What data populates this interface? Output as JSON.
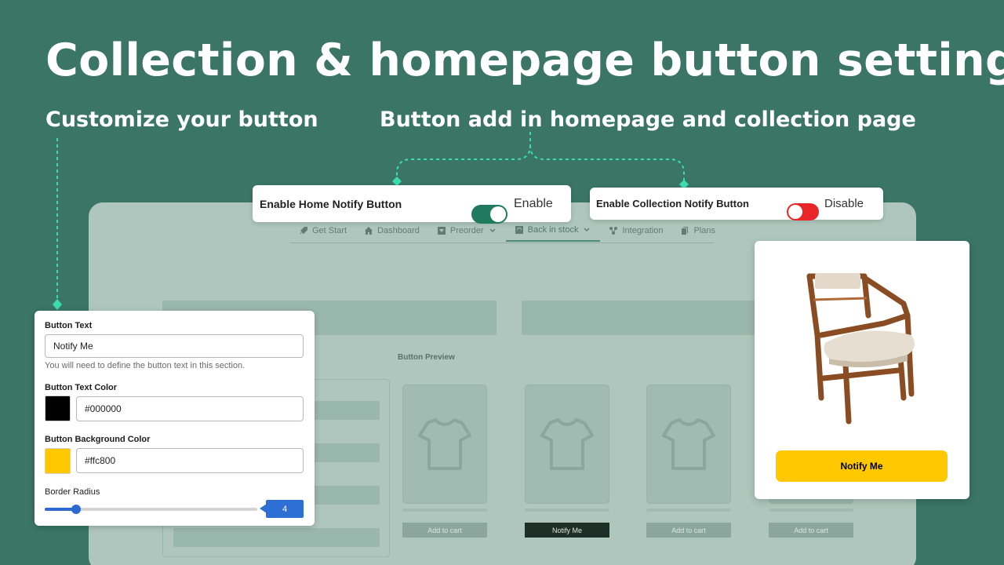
{
  "headline": "Collection & homepage button settings",
  "subheading_left": "Customize your button",
  "subheading_right": "Button add in homepage and collection page",
  "home_toggle": {
    "label": "Enable Home Notify Button",
    "state": "Enable",
    "on": true,
    "color": "#1f7a5e"
  },
  "collection_toggle": {
    "label": "Enable Collection Notify Button",
    "state": "Disable",
    "on": false,
    "color": "#e8262a"
  },
  "nav": {
    "items": [
      {
        "label": "Get Start",
        "icon": "rocket-icon"
      },
      {
        "label": "Dashboard",
        "icon": "home-icon"
      },
      {
        "label": "Preorder",
        "icon": "download-box-icon"
      },
      {
        "label": "Back in stock",
        "icon": "refresh-box-icon"
      },
      {
        "label": "Integration",
        "icon": "integration-icon"
      },
      {
        "label": "Plans",
        "icon": "plans-icon"
      }
    ]
  },
  "preview": {
    "title": "Button Preview",
    "buttons": [
      "Add to cart",
      "Notify Me",
      "Add to cart",
      "Add to cart"
    ]
  },
  "settings": {
    "button_text_label": "Button Text",
    "button_text_value": "Notify Me",
    "button_text_help": "You will need to define the button text in this section.",
    "text_color_label": "Button Text Color",
    "text_color_value": "#000000",
    "bg_color_label": "Button Background Color",
    "bg_color_value": "#ffc800",
    "radius_label": "Border Radius",
    "radius_value": "4",
    "radius_fraction": 0.15
  },
  "product": {
    "button_label": "Notify Me",
    "button_bg": "#ffc800",
    "button_text_color": "#000000"
  },
  "colors": {
    "background": "#3a7565",
    "accent_dashed": "#3ddbb0",
    "slider": "#2b6ad1"
  }
}
